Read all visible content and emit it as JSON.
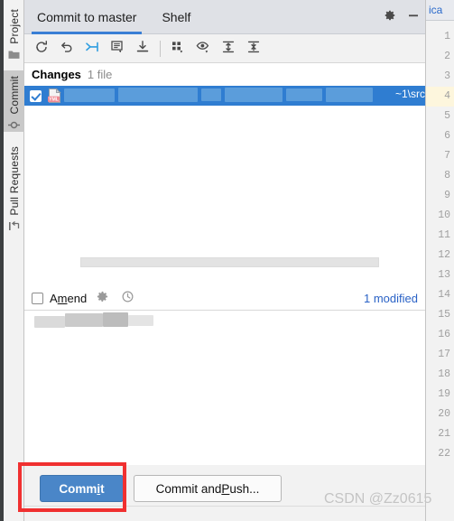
{
  "rail": {
    "items": [
      {
        "label": "Project",
        "icon": "folder-icon",
        "selected": false
      },
      {
        "label": "Commit",
        "icon": "commit-node-icon",
        "selected": true
      },
      {
        "label": "Pull Requests",
        "icon": "pull-request-icon",
        "selected": false
      }
    ]
  },
  "panel": {
    "tabs": [
      {
        "label": "Commit to master",
        "active": true
      },
      {
        "label": "Shelf",
        "active": false
      }
    ],
    "actions": [
      {
        "name": "settings-gear-icon",
        "glyph": "gear"
      },
      {
        "name": "minimize-icon",
        "glyph": "minus"
      }
    ],
    "toolbar": [
      {
        "name": "refresh-icon",
        "tip": "Refresh"
      },
      {
        "name": "rollback-icon",
        "tip": "Rollback"
      },
      {
        "name": "update-project-icon",
        "tip": "Update Project"
      },
      {
        "name": "show-diff-icon",
        "tip": "Show Diff"
      },
      {
        "name": "pull-icon",
        "tip": "Pull"
      },
      {
        "name": "group-by-icon",
        "tip": "Group By"
      },
      {
        "name": "preview-diff-icon",
        "tip": "Preview Diff"
      },
      {
        "name": "expand-all-icon",
        "tip": "Expand All"
      },
      {
        "name": "collapse-all-icon",
        "tip": "Collapse All"
      }
    ],
    "changes": {
      "title": "Changes",
      "count": "1 file",
      "row": {
        "checked": true,
        "file_icon_label": "YML",
        "tail_text": "~1\\src"
      }
    },
    "amend": {
      "label_before": "A",
      "label_mnemonic": "m",
      "label_after": "end",
      "checked": false,
      "icons": [
        {
          "name": "commit-options-gear-icon"
        },
        {
          "name": "commit-history-clock-icon"
        }
      ],
      "modified_link": "1 modified"
    },
    "buttons": {
      "commit": {
        "before": "Comm",
        "mnemonic": "i",
        "after": "t"
      },
      "commit_and_push": {
        "before": "Commit and ",
        "mnemonic": "P",
        "after": "ush..."
      }
    }
  },
  "editor": {
    "tab_text": "ica",
    "line_numbers": [
      "1",
      "2",
      "3",
      "4",
      "5",
      "6",
      "7",
      "8",
      "9",
      "10",
      "11",
      "12",
      "13",
      "14",
      "15",
      "16",
      "17",
      "18",
      "19",
      "20",
      "21",
      "22"
    ],
    "highlight_line": "4"
  },
  "watermark": "CSDN @Zz0615",
  "colors": {
    "accent_blue": "#3a7fd5",
    "selection_blue": "#2f7dd1",
    "button_blue": "#4a86c8",
    "link_blue": "#2a62c6",
    "annotation_red": "#f03030",
    "panel_gray": "#f2f2f2",
    "tabbar_gray": "#dfe1e6"
  }
}
